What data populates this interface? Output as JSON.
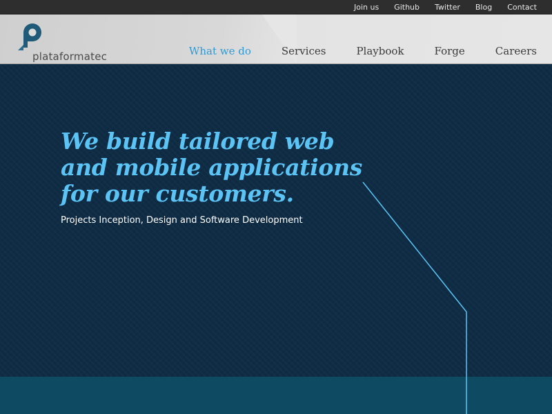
{
  "topbar": {
    "links": [
      "Join us",
      "Github",
      "Twitter",
      "Blog",
      "Contact"
    ]
  },
  "header": {
    "logo_text": "plataformatec",
    "logo_icon": "p-bubble-icon",
    "nav": [
      {
        "label": "What we do",
        "active": true
      },
      {
        "label": "Services",
        "active": false
      },
      {
        "label": "Playbook",
        "active": false
      },
      {
        "label": "Forge",
        "active": false
      },
      {
        "label": "Careers",
        "active": false
      }
    ]
  },
  "hero": {
    "headline_lines": [
      "We build tailored web",
      "and mobile applications",
      "for our customers."
    ],
    "subline": "Projects Inception, Design and Software Development"
  },
  "colors": {
    "accent": "#2f9ad6",
    "headline": "#5cc3f5",
    "hero_bg": "#0f2c45",
    "band_bg": "#0e4a62",
    "logo": "#1f5a78"
  }
}
